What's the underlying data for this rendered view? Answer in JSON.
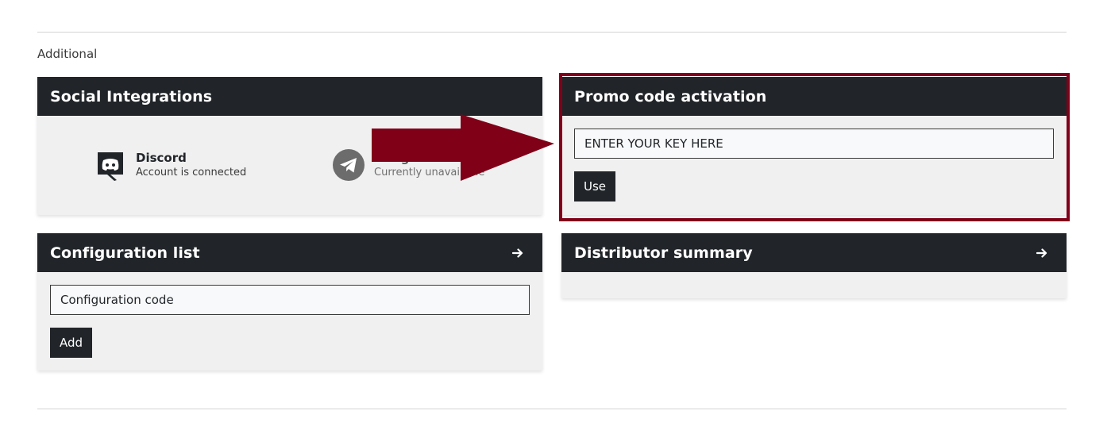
{
  "section": {
    "label": "Additional"
  },
  "social": {
    "title": "Social Integrations",
    "discord": {
      "name": "Discord",
      "status": "Account is connected",
      "icon": "discord-icon"
    },
    "telegram": {
      "name": "Telegram",
      "status": "Currently unavailable",
      "icon": "telegram-icon"
    }
  },
  "promo": {
    "title": "Promo code activation",
    "placeholder": "ENTER YOUR KEY HERE",
    "button_label": "Use"
  },
  "config": {
    "title": "Configuration list",
    "placeholder": "Configuration code",
    "button_label": "Add",
    "open_icon": "arrow-right-icon"
  },
  "distributor": {
    "title": "Distributor summary",
    "open_icon": "arrow-right-icon"
  },
  "annotation": {
    "highlight_color": "#800018",
    "arrow_color": "#800018"
  },
  "colors": {
    "header_bg": "#212529",
    "card_bg": "#f0f0f0"
  }
}
